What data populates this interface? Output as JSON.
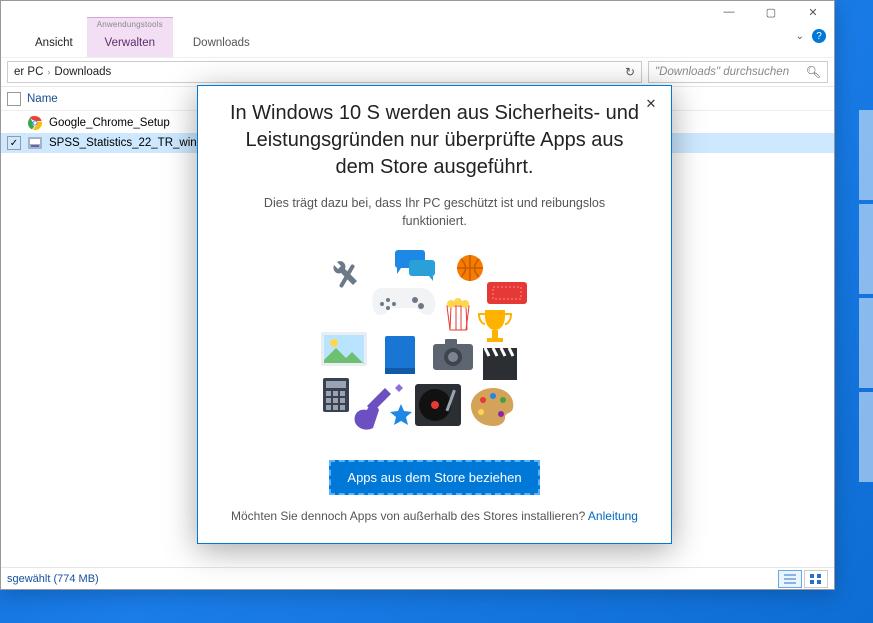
{
  "ribbon": {
    "view_tab": "Ansicht",
    "tools_header": "Anwendungstools",
    "tools_tab": "Verwalten",
    "window_title": "Downloads"
  },
  "breadcrumb": {
    "part1": "er PC",
    "part2": "Downloads"
  },
  "search": {
    "placeholder": "\"Downloads\" durchsuchen"
  },
  "columns": {
    "name": "Name"
  },
  "files": [
    {
      "name": "Google_Chrome_Setup",
      "selected": false
    },
    {
      "name": "SPSS_Statistics_22_TR_win6",
      "selected": true
    }
  ],
  "status": {
    "text": "sgewählt (774 MB)"
  },
  "dialog": {
    "title": "In Windows 10 S werden aus Sicherheits- und Leistungsgründen nur überprüfte Apps aus dem Store ausgeführt.",
    "subtitle": "Dies trägt dazu bei, dass Ihr PC geschützt ist und reibungslos funktioniert.",
    "button": "Apps aus dem Store beziehen",
    "footer_text": "Möchten Sie dennoch Apps von außerhalb des Stores installieren? ",
    "footer_link": "Anleitung"
  }
}
